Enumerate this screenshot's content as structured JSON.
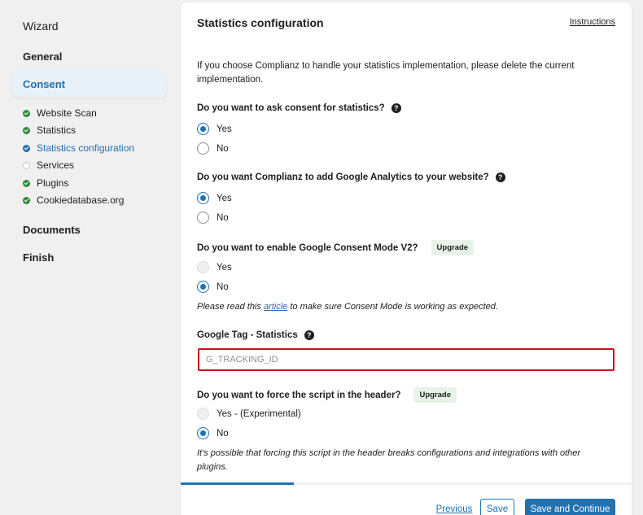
{
  "sidebar": {
    "title": "Wizard",
    "sections": {
      "general": "General",
      "consent": "Consent",
      "documents": "Documents",
      "finish": "Finish"
    },
    "steps": [
      {
        "label": "Website Scan",
        "status": "done"
      },
      {
        "label": "Statistics",
        "status": "done"
      },
      {
        "label": "Statistics configuration",
        "status": "current"
      },
      {
        "label": "Services",
        "status": "todo"
      },
      {
        "label": "Plugins",
        "status": "done"
      },
      {
        "label": "Cookiedatabase.org",
        "status": "done"
      }
    ]
  },
  "main": {
    "title": "Statistics configuration",
    "instructions_link": "Instructions",
    "intro": "If you choose Complianz to handle your statistics implementation, please delete the current implementation.",
    "q1": {
      "label": "Do you want to ask consent for statistics?",
      "options": [
        "Yes",
        "No"
      ],
      "selected": "Yes"
    },
    "q2": {
      "label": "Do you want Complianz to add Google Analytics to your website?",
      "options": [
        "Yes",
        "No"
      ],
      "selected": "Yes"
    },
    "q3": {
      "label": "Do you want to enable Google Consent Mode V2?",
      "badge": "Upgrade",
      "options": [
        "Yes",
        "No"
      ],
      "selected": "No",
      "note_before": "Please read this ",
      "note_link": "article",
      "note_after": " to make sure Consent Mode is working as expected."
    },
    "q4": {
      "label": "Google Tag - Statistics",
      "placeholder": "G_TRACKING_ID",
      "value": ""
    },
    "q5": {
      "label": "Do you want to force the script in the header?",
      "badge": "Upgrade",
      "options": [
        "Yes - (Experimental)",
        "No"
      ],
      "selected": "No",
      "note": "It's possible that forcing this script in the header breaks configurations and integrations with other plugins."
    }
  },
  "footer": {
    "previous": "Previous",
    "save": "Save",
    "save_continue": "Save and Continue",
    "progress": 0.25
  },
  "colors": {
    "accent": "#2271b1",
    "done": "#2e8a37",
    "error_border": "#c9141e"
  }
}
